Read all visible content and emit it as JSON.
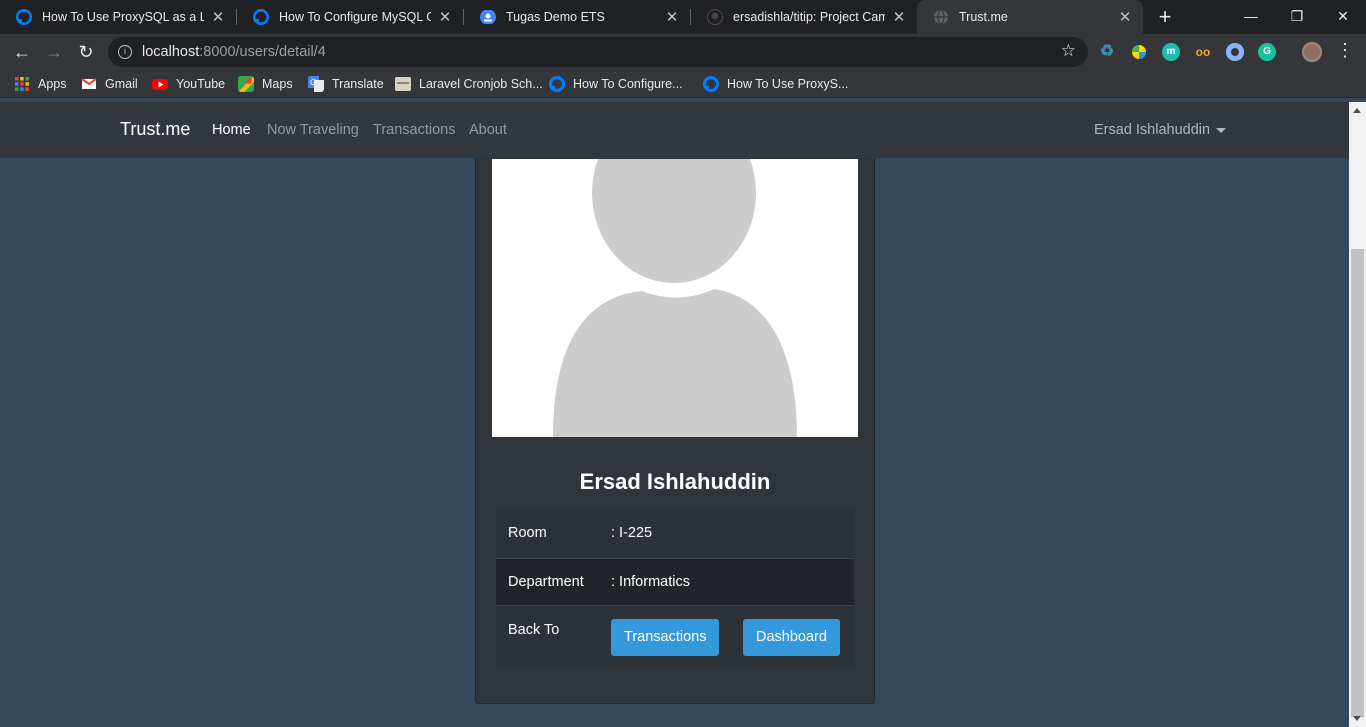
{
  "browser": {
    "tabs": [
      {
        "title": "How To Use ProxySQL as a Loa",
        "favicon": "digitalocean-icon",
        "active": false
      },
      {
        "title": "How To Configure MySQL Grou",
        "favicon": "digitalocean-icon",
        "active": false
      },
      {
        "title": "Tugas Demo ETS",
        "favicon": "classroom-icon",
        "active": false
      },
      {
        "title": "ersadishla/titip: Project Camin",
        "favicon": "github-icon",
        "active": false
      },
      {
        "title": "Trust.me",
        "favicon": "globe-icon",
        "active": true
      }
    ],
    "url": {
      "host": "localhost",
      "rest": ":8000/users/detail/4"
    },
    "bookmarks": [
      {
        "label": "Apps",
        "icon": "apps-grid-icon"
      },
      {
        "label": "Gmail",
        "icon": "gmail-icon"
      },
      {
        "label": "YouTube",
        "icon": "youtube-icon"
      },
      {
        "label": "Maps",
        "icon": "maps-icon"
      },
      {
        "label": "Translate",
        "icon": "translate-icon"
      },
      {
        "label": "Laravel Cronjob Sch...",
        "icon": "page-icon"
      },
      {
        "label": "How To Configure...",
        "icon": "digitalocean-icon"
      },
      {
        "label": "How To Use ProxyS...",
        "icon": "digitalocean-icon"
      }
    ],
    "colors": {
      "tabbar": "#202124",
      "toolbar": "#35363a",
      "accent_blue": "#3498db"
    }
  },
  "site": {
    "brand": "Trust.me",
    "nav": {
      "home": "Home",
      "now_traveling": "Now Traveling",
      "transactions": "Transactions",
      "about": "About",
      "user": "Ersad Ishlahuddin"
    }
  },
  "profile": {
    "name": "Ersad Ishlahuddin",
    "rows": {
      "room_label": "Room",
      "room_value": ": I-225",
      "department_label": "Department",
      "department_value": ": Informatics",
      "back_label": "Back To"
    },
    "buttons": {
      "transactions": "Transactions",
      "dashboard": "Dashboard"
    }
  }
}
